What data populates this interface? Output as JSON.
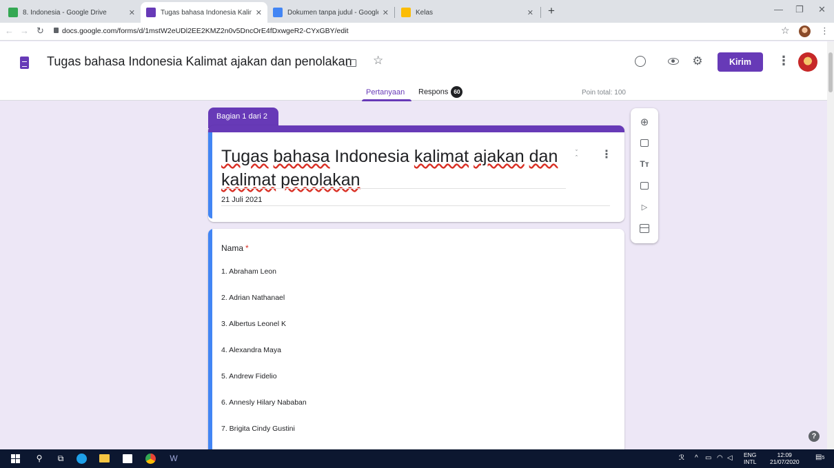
{
  "browser": {
    "tabs": [
      {
        "label": "8. Indonesia - Google Drive",
        "favicon_color": "#34a853"
      },
      {
        "label": "Tugas bahasa Indonesia Kalimat",
        "favicon_color": "#673ab7"
      },
      {
        "label": "Dokumen tanpa judul - Google D",
        "favicon_color": "#4285f4"
      },
      {
        "label": "Kelas",
        "favicon_color": "#fbbc05"
      }
    ],
    "url": "docs.google.com/forms/d/1mstW2eUDl2EE2KMZ2n0v5DncOrE4fDxwgeR2-CYxGBY/edit"
  },
  "header": {
    "doc_title": "Tugas bahasa Indonesia Kalimat ajakan dan penolakan",
    "send_label": "Kirim",
    "tabs": {
      "questions": "Pertanyaan",
      "responses": "Respons",
      "response_count": "60"
    },
    "total_points": "Poin total: 100"
  },
  "form": {
    "section_label": "Bagian 1 dari 2",
    "title_words": [
      "Tugas",
      "bahasa",
      "Indonesia",
      "kalimat",
      "ajakan",
      "dan",
      "kalimat",
      "penolakan"
    ],
    "description": "21 Juli 2021",
    "question": {
      "title": "Nama",
      "required_mark": "*",
      "options": [
        "1.  Abraham Leon",
        "2.  Adrian Nathanael",
        "3.  Albertus Leonel K",
        "4.  Alexandra Maya",
        "5.  Andrew Fidelio",
        "6.  Annesly Hilary Nababan",
        "7.  Brigita Cindy  Gustini"
      ]
    }
  },
  "taskbar": {
    "lang_top": "ENG",
    "lang_bottom": "INTL",
    "time": "12:09",
    "date": "21/07/2020",
    "notification_count": "5"
  },
  "colors": {
    "accent": "#673ab7",
    "background": "#ede7f6",
    "question_accent": "#4285f4"
  }
}
